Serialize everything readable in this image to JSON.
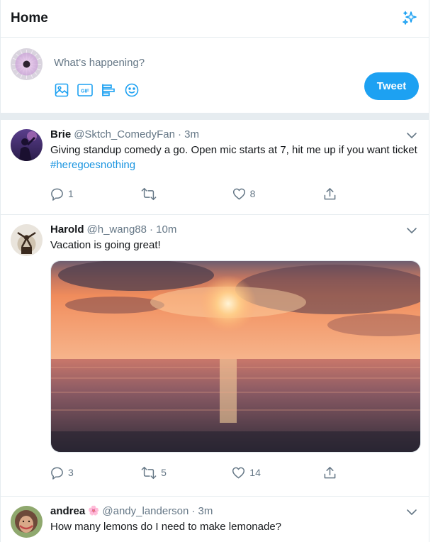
{
  "header": {
    "title": "Home",
    "icon": "sparkle-icon"
  },
  "compose": {
    "placeholder": "What’s happening?",
    "tools": [
      "image-icon",
      "gif-icon",
      "poll-icon",
      "emoji-icon"
    ],
    "gif_label": "GIF",
    "tweet_label": "Tweet"
  },
  "colors": {
    "accent": "#1da1f2",
    "secondary_text": "#657786",
    "border": "#e6ecf0",
    "hashtag": "#1b95e0"
  },
  "tweets": [
    {
      "name": "Brie",
      "handle": "@Sktch_ComedyFan",
      "time": "· 3m",
      "text": "Giving standup comedy a go. Open mic starts at 7, hit me up if you want ticket",
      "hashtag": "#heregoesnothing",
      "replies": "1",
      "retweets": "",
      "likes": "8"
    },
    {
      "name": "Harold",
      "handle": "@h_wang88",
      "time": "· 10m",
      "text": "Vacation is going great!",
      "image": "sunset-photo",
      "replies": "3",
      "retweets": "5",
      "likes": "14"
    },
    {
      "name": "andrea",
      "emoji": "🌸",
      "handle": "@andy_landerson",
      "time": "· 3m",
      "text": "How many lemons do I need to make lemonade?"
    }
  ]
}
